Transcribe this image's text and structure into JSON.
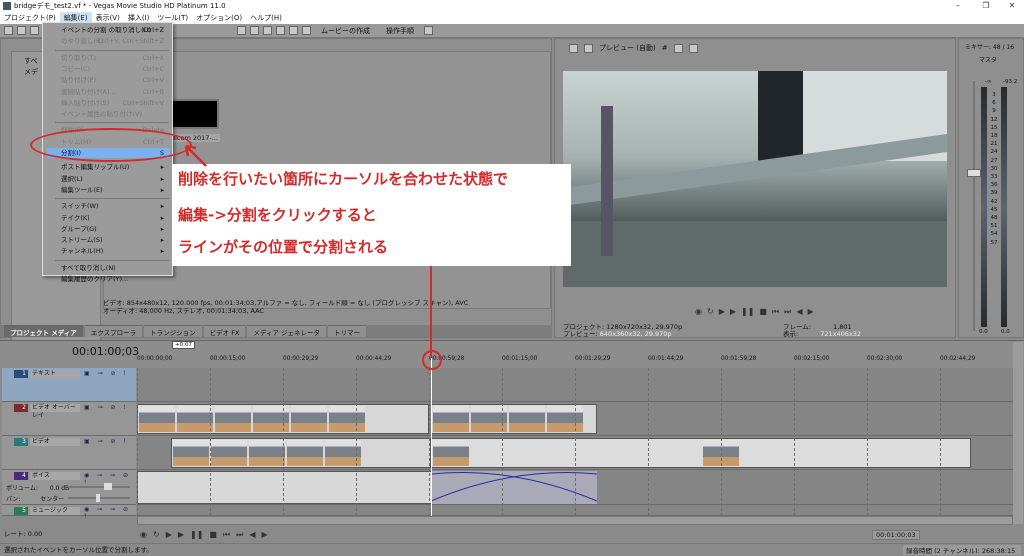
{
  "window": {
    "title": "bridgeデモ_test2.vf * - Vegas Movie Studio HD Platinum 11.0",
    "minimize": "–",
    "restore": "❐",
    "close": "✕"
  },
  "menubar": [
    "プロジェクト(P)",
    "編集(E)",
    "表示(V)",
    "挿入(I)",
    "ツール(T)",
    "オプション(O)",
    "ヘルプ(H)"
  ],
  "toolbar": {
    "make_movie": "ムービーの作成",
    "guide": "操作手順"
  },
  "edit_menu": {
    "items": [
      {
        "label": "イベントの分割 の取り消し(U)",
        "shortcut": "Ctrl+Z",
        "disabled": false
      },
      {
        "label": "のやり直し(R)",
        "shortcut": "Ctrl+Y, Ctrl+Shift+Z",
        "disabled": true
      },
      {
        "label": "切り取り(T)",
        "shortcut": "Ctrl+X",
        "disabled": true
      },
      {
        "label": "コピー(C)",
        "shortcut": "Ctrl+C",
        "disabled": true
      },
      {
        "label": "貼り付け(P)",
        "shortcut": "Ctrl+V",
        "disabled": true
      },
      {
        "label": "連続貼り付け(A)...",
        "shortcut": "Ctrl+B",
        "disabled": true
      },
      {
        "label": "挿入貼り付け(S)",
        "shortcut": "Ctrl+Shift+V",
        "disabled": true
      },
      {
        "label": "イベント属性の貼り付け(V)",
        "shortcut": "",
        "disabled": true
      },
      {
        "label": "削除(D)",
        "shortcut": "Delete",
        "disabled": true
      },
      {
        "label": "トリム(M)",
        "shortcut": "Ctrl+T",
        "disabled": true
      },
      {
        "label": "分割(I)",
        "shortcut": "S",
        "disabled": false,
        "highlighted": true
      },
      {
        "label": "ポスト編集リップル(U)",
        "shortcut": "▸",
        "disabled": false
      },
      {
        "label": "選択(L)",
        "shortcut": "▸",
        "disabled": false
      },
      {
        "label": "編集ツール(E)",
        "shortcut": "▸",
        "disabled": false
      },
      {
        "label": "スイッチ(W)",
        "shortcut": "▸",
        "disabled": false
      },
      {
        "label": "テイク(K)",
        "shortcut": "▸",
        "disabled": false
      },
      {
        "label": "グループ(G)",
        "shortcut": "▸",
        "disabled": false
      },
      {
        "label": "ストリーム(S)",
        "shortcut": "▸",
        "disabled": false
      },
      {
        "label": "チャンネル(H)",
        "shortcut": "▸",
        "disabled": false
      },
      {
        "label": "すべて取り消し(N)",
        "shortcut": "",
        "disabled": false
      },
      {
        "label": "編集履歴のクリア(Y)...",
        "shortcut": "",
        "disabled": false
      }
    ]
  },
  "media": {
    "tree": [
      "すべ",
      "メデ"
    ],
    "thumb_label": "dicam 2017-...",
    "info_video": "ビデオ: 854x480x12, 120.000 fps, 00:01:34;03,アルファ = なし, フィールド順 = なし (プログレッシブ スキャン), AVC",
    "info_audio": "オーディオ: 48,000 Hz, ステレオ, 00:01:34;03, AAC"
  },
  "tabs": [
    {
      "label": "プロジェクト メディア",
      "selected": true
    },
    {
      "label": "エクスプローラ"
    },
    {
      "label": "トランジション"
    },
    {
      "label": "ビデオ FX"
    },
    {
      "label": "メディア ジェネレータ"
    },
    {
      "label": "トリマー"
    }
  ],
  "preview": {
    "mode": "プレビュー (自動)",
    "project_label": "プロジェクト:",
    "project": "1280x720x32, 29.970p",
    "preview_label": "プレビュー:",
    "preview": "640x360x32, 29.970p",
    "frame_label": "フレーム:",
    "frame": "1,801",
    "display_label": "表示:",
    "display": "721x406x32"
  },
  "mixer": {
    "title": "ミキサー: 48 / 16",
    "master": "マスタ",
    "peak_left": "-∞",
    "peak_right": "-93.2",
    "scale": [
      "3",
      "6",
      "9",
      "12",
      "15",
      "18",
      "21",
      "24",
      "27",
      "30",
      "33",
      "36",
      "39",
      "42",
      "45",
      "48",
      "51",
      "54",
      "57"
    ],
    "level_left": "0.0",
    "level_right": "0.0"
  },
  "timeline": {
    "time": "00:01:00;03",
    "marker_offset": "+0:07",
    "ruler": [
      "00:00:00;00",
      "00:00:15;00",
      "00:00:29;29",
      "00:00:44;29",
      "00:00:59;28",
      "00:01:15;00",
      "00:01:29;29",
      "00:01:44;29",
      "00:01:59;28",
      "00:02:15;00",
      "00:02:30;00",
      "00:02:44;29"
    ],
    "tracks": [
      {
        "num": "1",
        "name": "テキスト",
        "color": "#2a4a7a"
      },
      {
        "num": "2",
        "name": "ビデオ オーバーレイ",
        "color": "#7a2a35"
      },
      {
        "num": "3",
        "name": "ビデオ",
        "color": "#2a7a7a"
      },
      {
        "num": "4",
        "name": "ボイス",
        "color": "#4a2a7a"
      },
      {
        "num": "5",
        "name": "ミュージック",
        "color": "#2a7a5a"
      }
    ],
    "volume_label": "ボリューム:",
    "volume": "0.0 dB",
    "pan_label": "パン:",
    "pan": "センター",
    "rate": "レート: 0.00",
    "cursor_time": "00:01:00;03"
  },
  "status": {
    "message": "選択されたイベントをカーソル位置で分割します。",
    "record_time": "録音時間 (2 チャンネル): 268:38:15"
  },
  "annotation": {
    "line1": "削除を行いたい箇所にカーソルを合わせた状態で",
    "line2": "編集->分割をクリックすると",
    "line3": "ラインがその位置で分割される",
    "color": "#d42a2a"
  }
}
